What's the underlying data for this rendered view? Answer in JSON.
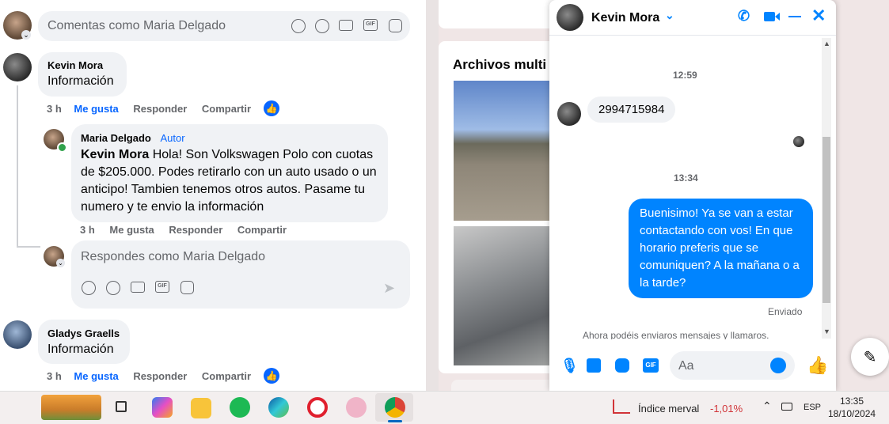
{
  "top_comment_box": {
    "placeholder": "Comentas como Maria Delgado"
  },
  "comments": [
    {
      "author": "Kevin Mora",
      "text": "Información",
      "time": "3 h",
      "like": "Me gusta",
      "reply": "Responder",
      "share": "Compartir"
    }
  ],
  "reply": {
    "author": "Maria Delgado",
    "badge": "Autor",
    "mention": "Kevin Mora",
    "text": " Hola! Son Volkswagen Polo con cuotas de $205.000. Podes retirarlo con un auto usado o un anticipo! Tambien tenemos otros autos. Pasame tu numero y te envio la información",
    "time": "3 h",
    "like": "Me gusta",
    "reply": "Responder",
    "share": "Compartir"
  },
  "reply_box": {
    "placeholder": "Respondes como Maria Delgado"
  },
  "comment2": {
    "author": "Gladys Graells",
    "text": "Información",
    "time": "3 h",
    "like": "Me gusta",
    "reply": "Responder",
    "share": "Compartir"
  },
  "media_panel": {
    "title": "Archivos multi"
  },
  "chat": {
    "contact": "Kevin Mora",
    "time1": "12:59",
    "incoming": "2994715984",
    "time2": "13:34",
    "outgoing": "Buenisimo! Ya se van a estar contactando con vos! En que horario preferis que se comuniquen? A la mañana o a la tarde?",
    "status": "Enviado",
    "notice": "Ahora podéis enviaros mensajes y llamaros.",
    "input_placeholder": "Aa"
  },
  "taskbar": {
    "stock_name": "Índice merval",
    "stock_change": "-1,01%",
    "lang": "ESP",
    "time": "13:35",
    "date": "18/10/2024"
  },
  "colors": {
    "accent": "#0866ff",
    "messenger_blue": "#0084ff",
    "negative": "#d13438"
  }
}
